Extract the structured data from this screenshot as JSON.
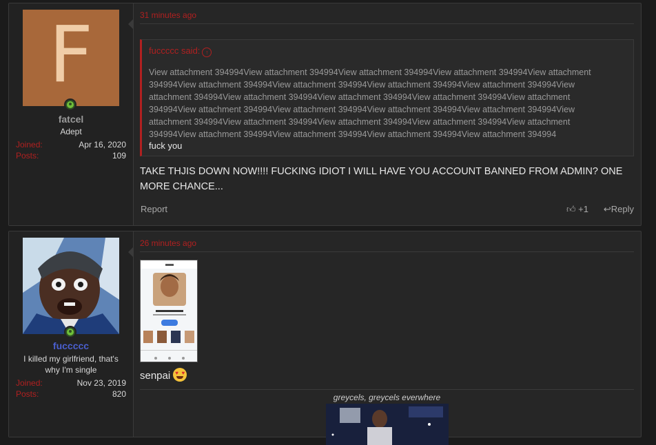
{
  "post1": {
    "time": "31 minutes ago",
    "user": {
      "initial": "F",
      "name": "fatcel",
      "title": "Adept",
      "joined_label": "Joined:",
      "joined": "Apr 16, 2020",
      "posts_label": "Posts:",
      "posts": "109",
      "name_color": "#9a9a9a"
    },
    "quote": {
      "author": "fuccccc said:",
      "body": "View attachment 394994View attachment 394994View attachment 394994View attachment 394994View attachment 394994View attachment 394994View attachment 394994View attachment 394994View attachment 394994View attachment 394994View attachment 394994View attachment 394994View attachment 394994View attachment 394994View attachment 394994View attachment 394994View attachment 394994View attachment 394994View attachment 394994View attachment 394994View attachment 394994View attachment 394994View attachment 394994View attachment 394994View attachment 394994View attachment 394994View attachment 394994",
      "last": "fuck you"
    },
    "message": "TAKE THJIS DOWN NOW!!!! FUCKING IDIOT I WILL HAVE YOU ACCOUNT BANNED FROM ADMIN? ONE MORE CHANCE...",
    "actions": {
      "report": "Report",
      "reaction": "+1",
      "reply": "Reply"
    }
  },
  "post2": {
    "time": "26 minutes ago",
    "user": {
      "name": "fuccccc",
      "title": "I killed my girlfriend, that's why I'm single",
      "joined_label": "Joined:",
      "joined": "Nov 23, 2019",
      "posts_label": "Posts:",
      "posts": "820",
      "name_color": "#4a5fd0"
    },
    "message": "senpai",
    "caption": "greycels, greycels everwhere"
  },
  "colors": {
    "accent": "#b12020",
    "online": "#6fbf3a"
  }
}
